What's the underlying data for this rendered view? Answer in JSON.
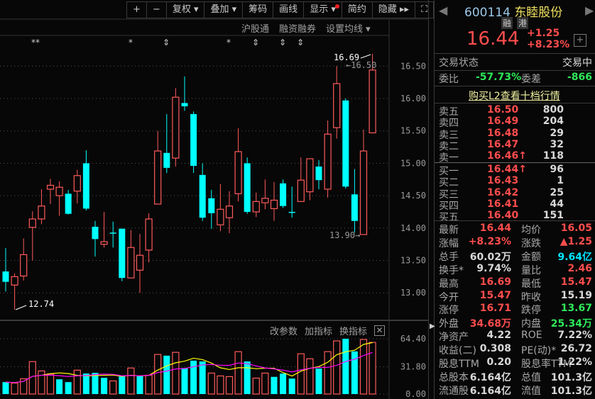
{
  "toolbar": {
    "zoom_in": "+",
    "zoom_out": "−",
    "fq": "复权 ▾",
    "overlay": "叠加 ▾",
    "chips": "筹码",
    "draw": "画线",
    "display": "显示 ▾",
    "simple": "简约",
    "hide": "隐藏 ▸▸",
    "fullscreen": "⛶"
  },
  "subbar": {
    "hsgt": "沪股通",
    "margin": "融资融券",
    "ma_setting": "设置均线 ▾"
  },
  "markers": [
    "**",
    "*",
    "⇕",
    "*",
    "⇕",
    "⇕",
    "⇕"
  ],
  "price_axis": [
    "16.50",
    "16.00",
    "15.50",
    "15.00",
    "14.50",
    "14.00",
    "13.50",
    "13.00"
  ],
  "annotations": {
    "high": "16.69",
    "high_prev": "16.50",
    "low": "12.74",
    "low_recent": "13.90"
  },
  "volume_pane": {
    "edit_params": "改参数",
    "add_indicator": "加指标",
    "switch_indicator": "换指标",
    "close": "✕",
    "axis": [
      "64.40",
      "31.80",
      "0.00"
    ]
  },
  "colors": {
    "up": "#ff5a5a",
    "down": "#00ffff",
    "ma5": "#ffff00",
    "ma10": "#ff00ff"
  },
  "candles": [
    [
      13.33,
      13.69,
      13.02,
      13.17
    ],
    [
      13.12,
      13.3,
      12.74,
      13.25
    ],
    [
      13.26,
      13.84,
      13.19,
      13.59
    ],
    [
      14.01,
      14.26,
      13.5,
      14.14
    ],
    [
      14.14,
      14.6,
      14.06,
      14.34
    ],
    [
      14.6,
      14.76,
      14.37,
      14.66
    ],
    [
      14.5,
      14.72,
      14.19,
      14.63
    ],
    [
      14.53,
      14.59,
      14.21,
      14.22
    ],
    [
      14.57,
      14.9,
      14.38,
      14.81
    ],
    [
      15.0,
      15.2,
      14.27,
      14.3
    ],
    [
      14.02,
      14.11,
      13.56,
      13.83
    ],
    [
      13.75,
      14.25,
      13.7,
      13.79
    ],
    [
      13.93,
      14.1,
      13.7,
      13.92
    ],
    [
      13.99,
      13.99,
      13.18,
      13.23
    ],
    [
      13.23,
      13.97,
      13.23,
      13.7
    ],
    [
      13.35,
      13.91,
      13.0,
      13.58
    ],
    [
      13.66,
      14.23,
      13.47,
      14.14
    ],
    [
      14.37,
      15.5,
      14.37,
      15.19
    ],
    [
      15.16,
      15.76,
      14.85,
      14.93
    ],
    [
      15.08,
      16.16,
      14.95,
      16.02
    ],
    [
      15.93,
      16.34,
      15.81,
      15.88
    ],
    [
      15.76,
      15.8,
      14.85,
      14.96
    ],
    [
      14.82,
      15.0,
      14.11,
      14.16
    ],
    [
      14.46,
      14.59,
      13.99,
      14.23
    ],
    [
      14.05,
      14.68,
      13.95,
      14.29
    ],
    [
      14.16,
      14.57,
      13.92,
      14.34
    ],
    [
      14.53,
      15.54,
      14.41,
      15.18
    ],
    [
      15.0,
      15.09,
      14.22,
      14.25
    ],
    [
      14.25,
      14.55,
      14.17,
      14.41
    ],
    [
      14.39,
      14.75,
      14.29,
      14.46
    ],
    [
      14.3,
      14.71,
      14.11,
      14.43
    ],
    [
      14.69,
      14.75,
      14.31,
      14.34
    ],
    [
      14.25,
      14.64,
      14.16,
      14.24
    ],
    [
      14.41,
      15.09,
      14.41,
      14.74
    ],
    [
      14.56,
      15.07,
      14.43,
      15.07
    ],
    [
      14.95,
      15.05,
      14.6,
      14.74
    ],
    [
      14.6,
      15.66,
      14.47,
      15.45
    ],
    [
      15.55,
      16.5,
      15.38,
      16.23
    ],
    [
      15.97,
      16.0,
      14.61,
      14.64
    ],
    [
      14.52,
      14.91,
      13.93,
      14.11
    ],
    [
      13.9,
      15.52,
      13.9,
      15.19
    ],
    [
      15.47,
      16.69,
      15.47,
      16.44
    ]
  ],
  "volumes": [
    13.9,
    12.8,
    17.8,
    37.8,
    26.9,
    23.3,
    17.2,
    13.9,
    27.8,
    23.9,
    24.7,
    18.9,
    15.3,
    20.5,
    30.3,
    20.8,
    21.9,
    46.1,
    44.7,
    48.6,
    30.3,
    38.9,
    38.0,
    24.4,
    21.1,
    20.3,
    49.4,
    38.0,
    18.6,
    24.4,
    20.0,
    23.9,
    18.0,
    46.9,
    41.1,
    29.7,
    49.4,
    61.9,
    64.4,
    49.7,
    63.6,
    60.2
  ],
  "quote": {
    "code": "600114",
    "name": "东睦股份",
    "badge1": "融",
    "badge2": "港",
    "price": "16.44",
    "change": "+1.25",
    "change_pct": "+8.23%",
    "add": "+",
    "status_label": "交易状态",
    "status": "交易中",
    "wb_label": "委比",
    "wb": "-57.73%",
    "wc_label": "委差",
    "wc": "-866",
    "l2_link": "购买L2查看十档行情"
  },
  "asks": [
    {
      "label": "卖五",
      "price": "16.50",
      "vol": "800"
    },
    {
      "label": "卖四",
      "price": "16.49",
      "vol": "204"
    },
    {
      "label": "卖三",
      "price": "16.48",
      "vol": "29"
    },
    {
      "label": "卖二",
      "price": "16.47",
      "vol": "32"
    },
    {
      "label": "卖一",
      "price": "16.46↑",
      "vol": "118"
    }
  ],
  "bids": [
    {
      "label": "买一",
      "price": "16.44↑",
      "vol": "96"
    },
    {
      "label": "买二",
      "price": "16.43",
      "vol": "1"
    },
    {
      "label": "买三",
      "price": "16.42",
      "vol": "25"
    },
    {
      "label": "买四",
      "price": "16.41",
      "vol": "44"
    },
    {
      "label": "买五",
      "price": "16.40",
      "vol": "151"
    }
  ],
  "stats": [
    {
      "l1": "最新",
      "v1": "16.44",
      "c1": "red",
      "l2": "均价",
      "v2": "16.05",
      "c2": "red"
    },
    {
      "l1": "涨幅",
      "v1": "+8.23%",
      "c1": "red",
      "l2": "涨跌",
      "v2": "▲1.25",
      "c2": "red"
    },
    {
      "l1": "总手",
      "v1": "60.02万",
      "c1": "wht",
      "l2": "金额",
      "v2": "9.64亿",
      "c2": "cyn"
    },
    {
      "l1": "换手*",
      "v1": "9.74%",
      "c1": "wht",
      "l2": "量比",
      "v2": "2.46",
      "c2": "red"
    },
    {
      "l1": "最高",
      "v1": "16.69",
      "c1": "red",
      "l2": "最低",
      "v2": "15.47",
      "c2": "red"
    },
    {
      "l1": "今开",
      "v1": "15.47",
      "c1": "red",
      "l2": "昨收",
      "v2": "15.19",
      "c2": "wht"
    },
    {
      "l1": "涨停",
      "v1": "16.71",
      "c1": "red",
      "l2": "跌停",
      "v2": "13.67",
      "c2": "grn"
    },
    {
      "l1": "外盘",
      "v1": "34.68万",
      "c1": "red",
      "l2": "内盘",
      "v2": "25.34万",
      "c2": "grn"
    },
    {
      "l1": "净资产",
      "v1": "4.22",
      "c1": "wht",
      "l2": "ROE",
      "v2": "7.22%",
      "c2": "wht"
    },
    {
      "l1": "收益(二)",
      "v1": "0.308",
      "c1": "wht",
      "l2": "PE(动)*",
      "v2": "26.72",
      "c2": "wht"
    },
    {
      "l1": "股息TTM",
      "v1": "0.20",
      "c1": "wht",
      "l2": "股息率TTM",
      "v2": "1.22%",
      "c2": "wht"
    },
    {
      "l1": "总股本",
      "v1": "6.164亿",
      "c1": "wht",
      "l2": "总值",
      "v2": "101.3亿",
      "c2": "wht"
    },
    {
      "l1": "流通股",
      "v1": "6.164亿",
      "c1": "wht",
      "l2": "流值",
      "v2": "101.3亿",
      "c2": "wht"
    }
  ]
}
